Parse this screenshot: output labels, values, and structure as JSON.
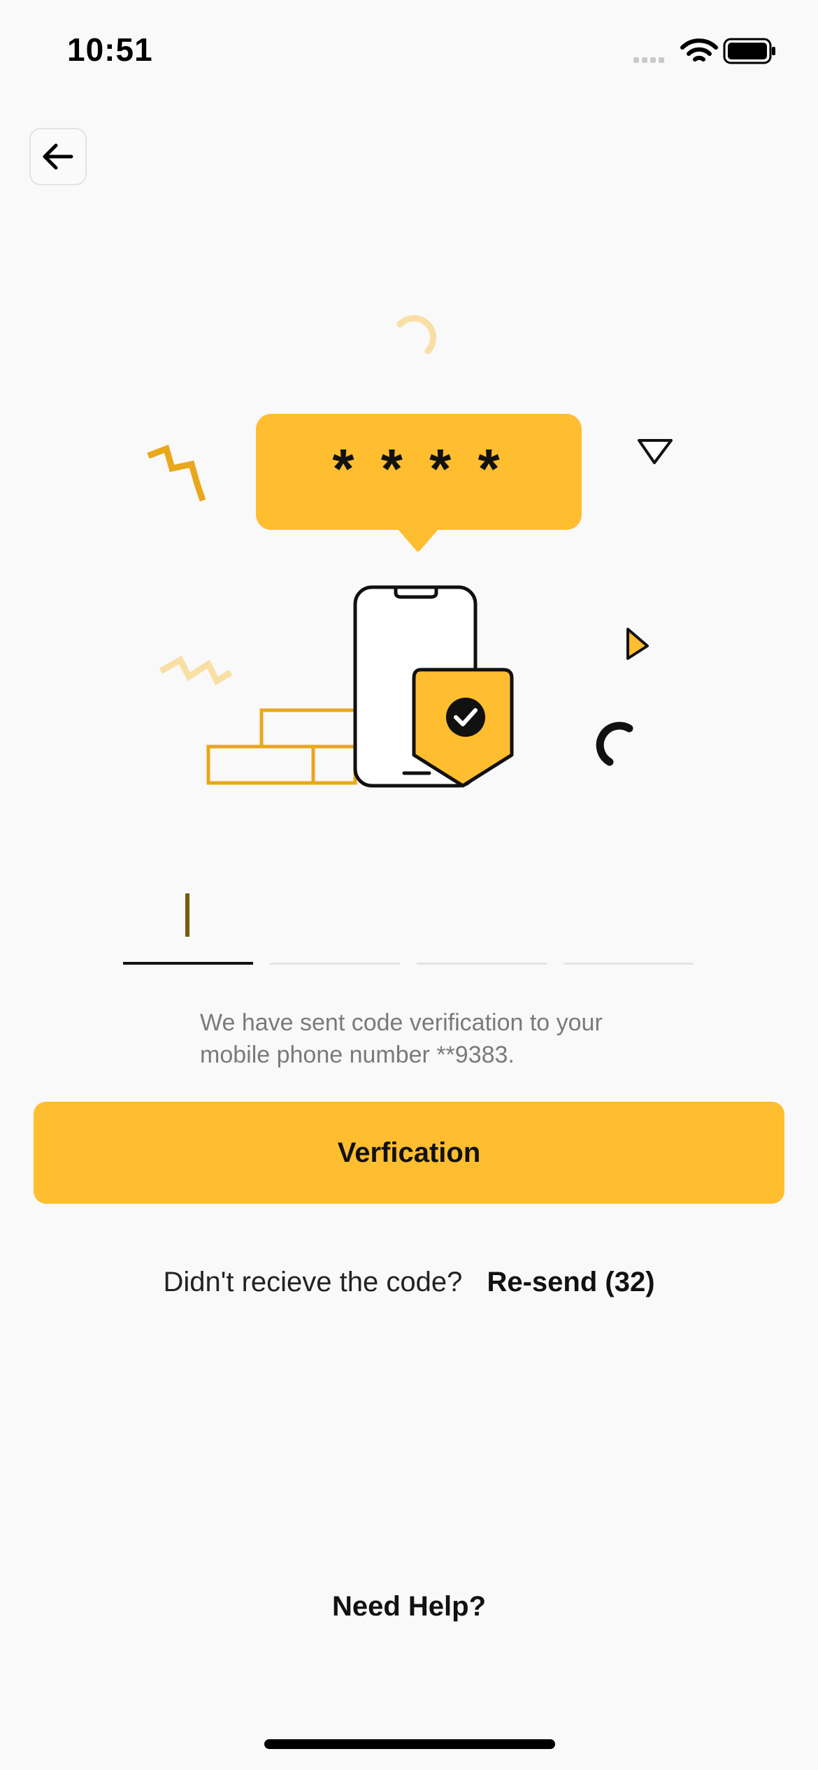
{
  "status_bar": {
    "time": "10:51",
    "icons": [
      "signal-icon",
      "wifi-icon",
      "battery-icon"
    ]
  },
  "nav": {
    "back_icon": "arrow-left-icon"
  },
  "illustration": {
    "bubble_text": "* * * *",
    "accent_color": "#ffbd30",
    "secondary_color": "#e9a71a"
  },
  "otp": {
    "digits": [
      "",
      "",
      "",
      ""
    ],
    "active_index": 0
  },
  "info": {
    "line1": "We have sent code verification to your",
    "line2": "mobile phone number **9383."
  },
  "verify_button": {
    "label": "Verfication",
    "color": "#ffbd30"
  },
  "resend": {
    "question": "Didn't recieve the code?",
    "link": "Re-send (32)"
  },
  "help": {
    "label": "Need Help?"
  }
}
